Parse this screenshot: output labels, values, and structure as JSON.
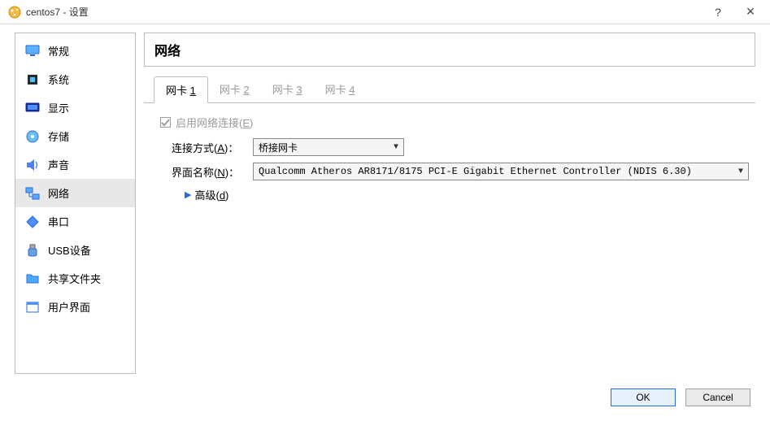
{
  "window": {
    "title": "centos7 - 设置",
    "help_symbol": "?",
    "close_symbol": "×"
  },
  "sidebar": {
    "items": [
      {
        "label": "常规"
      },
      {
        "label": "系统"
      },
      {
        "label": "显示"
      },
      {
        "label": "存储"
      },
      {
        "label": "声音"
      },
      {
        "label": "网络"
      },
      {
        "label": "串口"
      },
      {
        "label": "USB设备"
      },
      {
        "label": "共享文件夹"
      },
      {
        "label": "用户界面"
      }
    ],
    "selected_index": 5
  },
  "content": {
    "header": "网络",
    "tabs": [
      {
        "prefix": "网卡 ",
        "num": "1"
      },
      {
        "prefix": "网卡 ",
        "num": "2"
      },
      {
        "prefix": "网卡 ",
        "num": "3"
      },
      {
        "prefix": "网卡 ",
        "num": "4"
      }
    ],
    "active_tab": 0,
    "enable_row": {
      "text_before": "启用网络连接(",
      "accel": "E",
      "text_after": ")",
      "checked": true
    },
    "attach_row": {
      "label_before": "连接方式(",
      "accel": "A",
      "label_after": ")",
      "value": "桥接网卡"
    },
    "iface_row": {
      "label_before": "界面名称(",
      "accel": "N",
      "label_after": ")",
      "value": "Qualcomm Atheros AR8171/8175 PCI-E Gigabit Ethernet Controller (NDIS 6.30)"
    },
    "advanced": {
      "text_before": "高级(",
      "accel": "d",
      "text_after": ")"
    }
  },
  "buttons": {
    "ok": "OK",
    "cancel": "Cancel"
  }
}
